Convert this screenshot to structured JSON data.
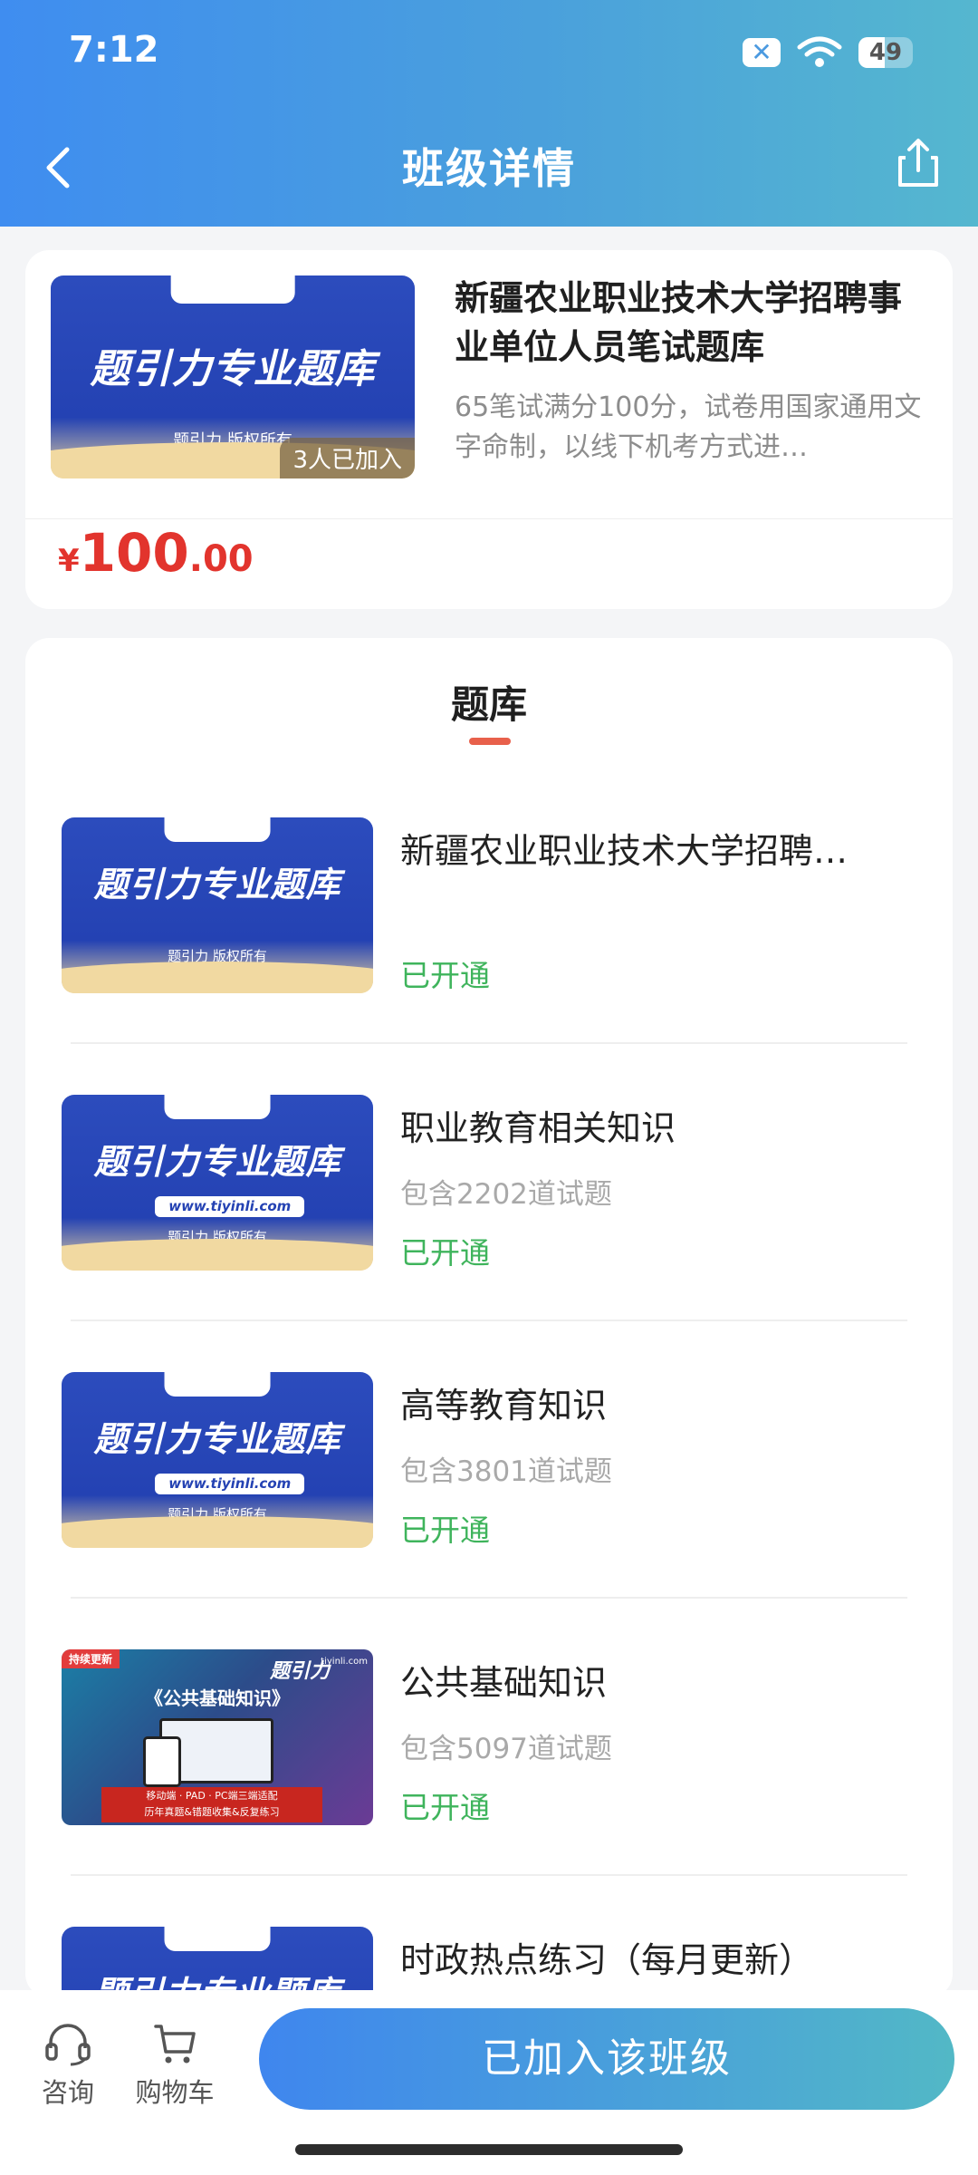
{
  "status_bar": {
    "time": "7:12",
    "battery": "49",
    "battery_level": 0.49
  },
  "header": {
    "title": "班级详情"
  },
  "class_info": {
    "cover": {
      "brand": "题引力专业题库",
      "tag": "题引力",
      "footer": "题引力 版权所有",
      "joined": "3人已加入"
    },
    "title": "新疆农业职业技术大学招聘事业单位人员笔试题库",
    "description": "65笔试满分100分，试卷用国家通用文字命制，以线下机考方式进…",
    "price": {
      "symbol": "¥",
      "integer": "100",
      "decimal": ".00"
    }
  },
  "question_bank": {
    "title": "题库",
    "items": [
      {
        "name": "新疆农业职业技术大学招聘…",
        "count": "",
        "status": "已开通",
        "cover": {
          "brand": "题引力专业题库",
          "tag": "题引力",
          "footer": "题引力 版权所有",
          "url": ""
        }
      },
      {
        "name": "职业教育相关知识",
        "count": "包含2202道试题",
        "status": "已开通",
        "cover": {
          "brand": "题引力专业题库",
          "tag": "题引力",
          "footer": "题引力 版权所有",
          "url": "www.tiyinli.com"
        }
      },
      {
        "name": "高等教育知识",
        "count": "包含3801道试题",
        "status": "已开通",
        "cover": {
          "brand": "题引力专业题库",
          "tag": "题引力",
          "footer": "题引力 版权所有",
          "url": "www.tiyinli.com"
        }
      },
      {
        "name": "公共基础知识",
        "count": "包含5097道试题",
        "status": "已开通",
        "cover": {
          "ribbon": "持续更新",
          "title": "《公共基础知识》",
          "logo": "题引力",
          "site": "tiyinli.com",
          "line1": "移动端 · PAD · PC端三端适配",
          "line2": "历年真题&错题收集&反复练习"
        }
      },
      {
        "name": "时政热点练习（每月更新）",
        "count": "",
        "status": "",
        "cover": {
          "brand": "题引力专业题库",
          "tag": "题引力",
          "footer": "",
          "url": ""
        }
      }
    ]
  },
  "bottom_bar": {
    "consult": "咨询",
    "cart": "购物车",
    "joined_button": "已加入该班级"
  },
  "colors": {
    "price": "#e2342d",
    "status_open": "#3fb45c",
    "accent": "#e8604b"
  }
}
